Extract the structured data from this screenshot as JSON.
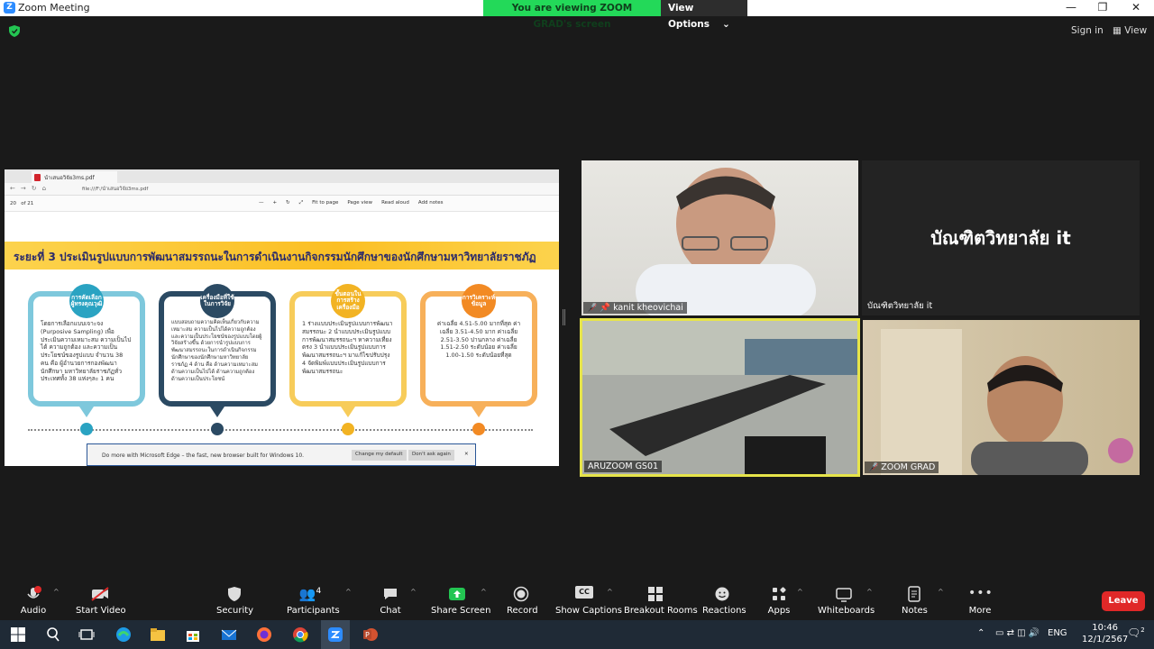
{
  "window": {
    "title": "Zoom Meeting",
    "minimize": "—",
    "maximize": "❐",
    "close": "✕"
  },
  "share_banner": {
    "status": "You are viewing ZOOM GRAD's screen",
    "options": "View Options",
    "chevron": "⌄"
  },
  "topright": {
    "sign_in": "Sign in",
    "view": "View"
  },
  "shared_screen": {
    "tab_title": "นำเสนอวิจัย3ms.pdf",
    "url": "file:///F:/นำเสนอวิจัย3ms.pdf",
    "page_current": "20",
    "page_total": "of 21",
    "tools": [
      "—",
      "+",
      "↻",
      "⤢",
      "Fit to page",
      "Page view",
      "Read aloud",
      "Add notes"
    ],
    "slide": {
      "title": "ระยะที่ 3 ประเมินรูปแบบการพัฒนาสมรรถนะในการดำเนินงานกิจกรรมนักศึกษาของนักศึกษามหาวิทยาลัยราชภัฏ",
      "boxes": [
        {
          "head": "การคัดเลือกผู้ทรงคุณวุฒิ",
          "body": "โดยการเลือกแบบเจาะจง (Purposive Sampling) เพื่อประเมินความเหมาะสม ความเป็นไปได้ ความถูกต้อง และความเป็นประโยชน์ของรูปแบบ จำนวน 38 คน คือ ผู้อำนวยการกองพัฒนานักศึกษา มหาวิทยาลัยราชภัฏทั่วประเทศทั้ง 38 แห่งๆละ 1 คน",
          "color": "#2aa3c2"
        },
        {
          "head": "เครื่องมือที่ใช้ในการวิจัย",
          "body": "แบบสอบถามความคิดเห็นเกี่ยวกับความเหมาะสม ความเป็นไปได้ความถูกต้อง และความเป็นประโยชน์ของรูปแบบโดยผู้วิจัยสร้างขึ้น ด้วยการนำรูปแบบการพัฒนาสมรรถนะในการดำเนินกิจกรรมนักศึกษาของนักศึกษามหาวิทยาลัยราชภัฏ 4 ด้าน คือ ด้านความเหมาะสม ด้านความเป็นไปได้ ด้านความถูกต้อง ด้านความเป็นประโยชน์",
          "color": "#2b4a63"
        },
        {
          "head": "ขั้นตอนในการสร้างเครื่องมือ",
          "body": "1 ร่างแบบประเมินรูปแบบการพัฒนาสมรรถนะ 2 นำแบบประเมินรูปแบบการพัฒนาสมรรถนะฯ หาความเที่ยงตรง 3 นำแบบประเมินรูปแบบการพัฒนาสมรรถนะฯ มาแก้ไขปรับปรุง 4 จัดพิมพ์แบบประเมินรูปแบบการพัฒนาสมรรถนะ",
          "color": "#f2b323"
        },
        {
          "head": "การวิเคราะห์ข้อมูล",
          "body": "ค่าเฉลี่ย 4.51-5.00 มากที่สุด ค่าเฉลี่ย 3.51-4.50 มาก ค่าเฉลี่ย 2.51-3.50 ปานกลาง ค่าเฉลี่ย 1.51-2.50 ระดับน้อย ค่าเฉลี่ย 1.00-1.50 ระดับน้อยที่สุด",
          "color": "#f28a24"
        }
      ]
    },
    "edge_bar": {
      "message": "Do more with Microsoft Edge – the fast, new browser built for Windows 10.",
      "change": "Change my default",
      "dont_ask": "Don't ask again",
      "close": "✕"
    }
  },
  "participants": [
    {
      "name": "kanit kheovichai"
    },
    {
      "name": "บัณฑิตวิทยาลัย  it",
      "big_label": "บัณฑิตวิทยาลัย  it"
    },
    {
      "name": "ARUZOOM GS01"
    },
    {
      "name": "ZOOM GRAD"
    }
  ],
  "toolbar": {
    "audio": "Audio",
    "start_video": "Start Video",
    "security": "Security",
    "participants": "Participants",
    "participants_count": "4",
    "chat": "Chat",
    "share_screen": "Share Screen",
    "record": "Record",
    "show_captions": "Show Captions",
    "breakout_rooms": "Breakout Rooms",
    "reactions": "Reactions",
    "apps": "Apps",
    "whiteboards": "Whiteboards",
    "notes": "Notes",
    "more": "More",
    "leave": "Leave",
    "cc": "CC",
    "caret": "^"
  },
  "taskbar": {
    "lang": "ENG",
    "time": "10:46",
    "date": "12/1/2567",
    "notif": "2"
  },
  "colors": {
    "zoom_blue": "#2d8cff",
    "share_green": "#23d959",
    "leave_red": "#e02828",
    "speaker_border": "#e6e44a"
  }
}
